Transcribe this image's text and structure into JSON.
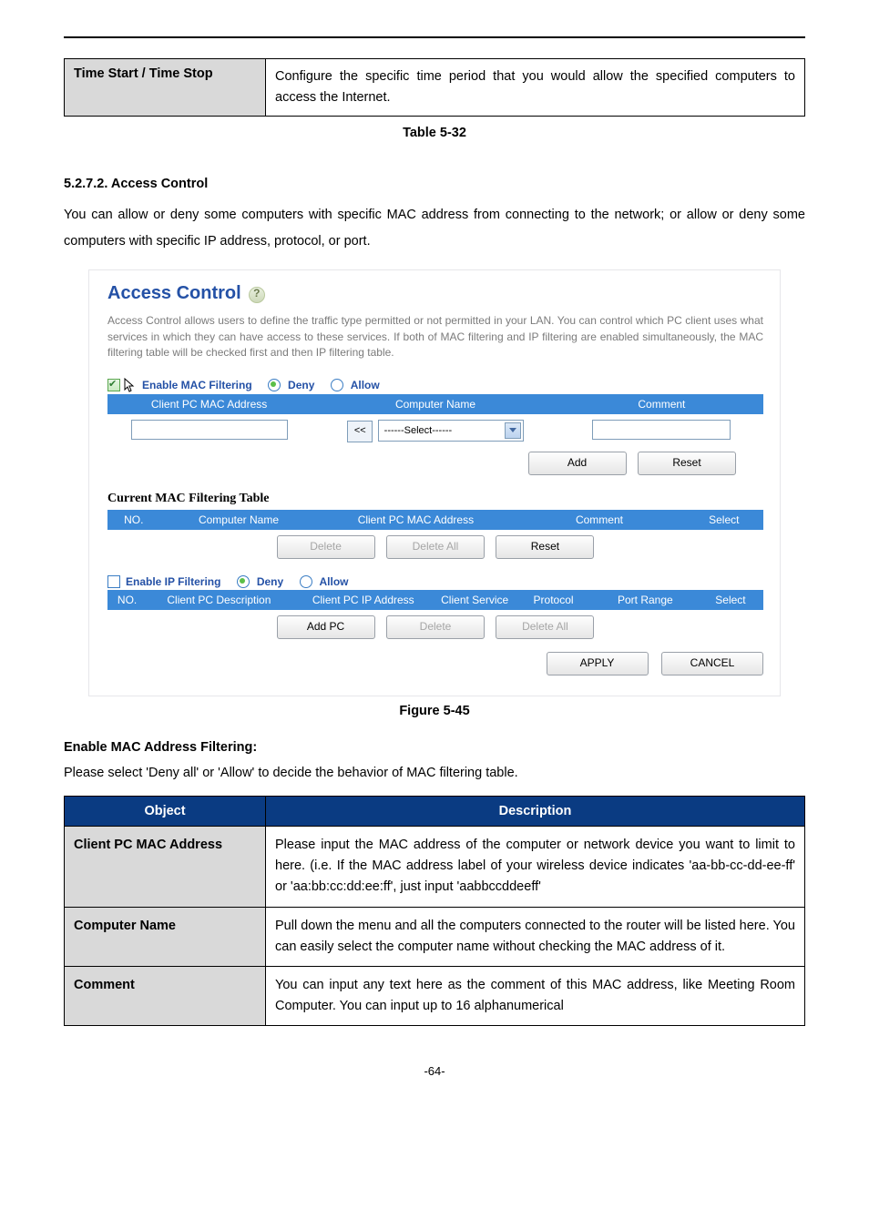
{
  "topTable": {
    "label": "Time Start / Time Stop",
    "desc": "Configure the specific time period that you would allow the specified computers to access the Internet."
  },
  "topTableCaption": "Table 5-32",
  "section": {
    "number": "5.2.7.2.",
    "title": "Access Control",
    "body": "You can allow or deny some computers with specific MAC address from connecting to the network; or allow or deny some computers with specific IP address, protocol, or port."
  },
  "acPanel": {
    "title": "Access Control",
    "desc": "Access Control allows users to define the traffic type permitted or not permitted in your LAN. You can control which PC client uses what services in which they can have access to these services. If both of MAC filtering and IP filtering are enabled simultaneously, the MAC filtering table will be checked first and then IP filtering table.",
    "macFilter": {
      "enableLabel": "Enable MAC Filtering",
      "deny": "Deny",
      "allow": "Allow",
      "col1": "Client PC MAC Address",
      "col2": "Computer Name",
      "col3": "Comment",
      "lt": "<<",
      "selectPlaceholder": "------Select------",
      "addBtn": "Add",
      "resetBtn": "Reset"
    },
    "macTable": {
      "heading": "Current MAC Filtering Table",
      "c1": "NO.",
      "c2": "Computer Name",
      "c3": "Client PC MAC Address",
      "c4": "Comment",
      "c5": "Select",
      "deleteBtn": "Delete",
      "deleteAllBtn": "Delete All",
      "resetBtn": "Reset"
    },
    "ipFilter": {
      "enableLabel": "Enable IP Filtering",
      "deny": "Deny",
      "allow": "Allow",
      "c1": "NO.",
      "c2": "Client PC Description",
      "c3": "Client PC IP Address",
      "c4": "Client Service",
      "c5": "Protocol",
      "c6": "Port Range",
      "c7": "Select",
      "addPc": "Add PC",
      "deleteBtn": "Delete",
      "deleteAllBtn": "Delete All"
    },
    "applyBtn": "APPLY",
    "cancelBtn": "CANCEL"
  },
  "figCaption": "Figure 5-45",
  "macHeading": "Enable MAC Address Filtering",
  "macPara": "Please select 'Deny all' or 'Allow' to decide the behavior of MAC filtering table.",
  "objTable": {
    "h1": "Object",
    "h2": "Description",
    "r1l": "Client PC MAC Address",
    "r1d": "Please input the MAC address of the computer or network device you want to limit to here. (i.e. If the MAC address label of your wireless device indicates 'aa-bb-cc-dd-ee-ff' or 'aa:bb:cc:dd:ee:ff', just input 'aabbccddeeff'",
    "r2l": "Computer Name",
    "r2d": "Pull down the menu and all the computers connected to the router will be listed here. You can easily select the computer name without checking the MAC address of it.",
    "r3l": "Comment",
    "r3d": "You can input any text here as the comment of this MAC address, like Meeting Room Computer. You can input up to 16 alphanumerical"
  },
  "pageNum": "-64-"
}
